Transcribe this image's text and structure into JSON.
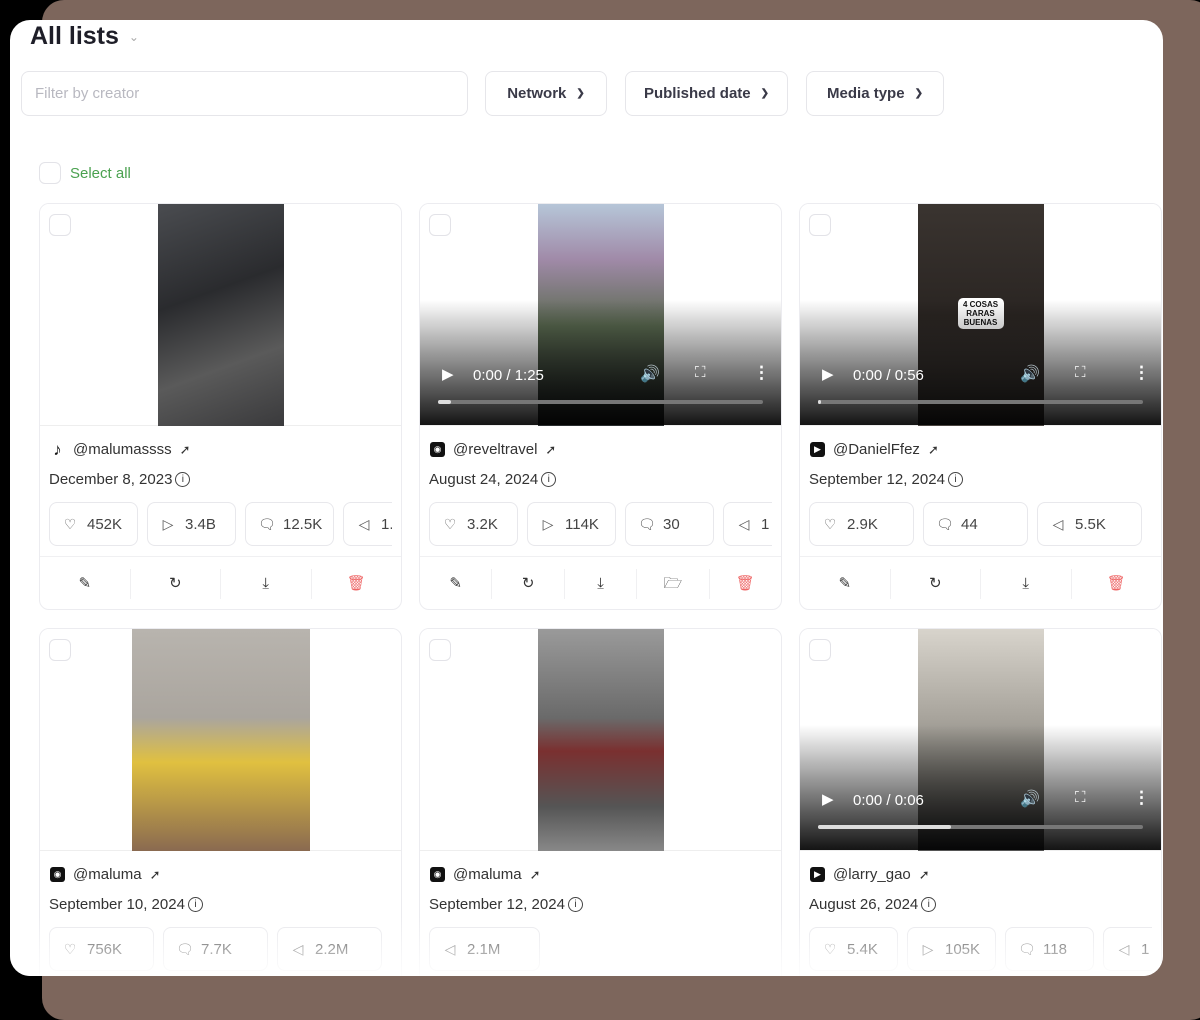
{
  "header": {
    "title": "All lists"
  },
  "filters": {
    "creator_placeholder": "Filter by creator",
    "network": "Network",
    "published_date": "Published date",
    "media_type": "Media type"
  },
  "select_all": "Select all",
  "colors": {
    "accent_green": "#4aa14f",
    "delete_red": "#e66666",
    "frame_brown": "#7d665c"
  },
  "cards": [
    {
      "network": "tiktok",
      "handle": "@malumassss",
      "date": "December 8, 2023",
      "media": "image",
      "stats": [
        {
          "icon": "heart",
          "value": "452K"
        },
        {
          "icon": "play",
          "value": "3.4B"
        },
        {
          "icon": "comment",
          "value": "12.5K"
        },
        {
          "icon": "megaphone",
          "value": "1."
        }
      ],
      "actions": [
        "edit",
        "refresh",
        "download",
        "delete"
      ]
    },
    {
      "network": "instagram",
      "handle": "@reveltravel",
      "date": "August 24, 2024",
      "media": "video",
      "time": "0:00 / 1:25",
      "progress": 0.04,
      "stats": [
        {
          "icon": "heart",
          "value": "3.2K"
        },
        {
          "icon": "play",
          "value": "114K"
        },
        {
          "icon": "comment",
          "value": "30"
        },
        {
          "icon": "megaphone",
          "value": "1"
        }
      ],
      "actions": [
        "edit",
        "refresh",
        "download",
        "folder",
        "delete"
      ]
    },
    {
      "network": "youtube",
      "handle": "@DanielFfez",
      "date": "September 12, 2024",
      "media": "video",
      "time": "0:00 / 0:56",
      "overlay_text": "4 COSAS RARAS BUENAS",
      "progress": 0.01,
      "stats": [
        {
          "icon": "heart",
          "value": "2.9K"
        },
        {
          "icon": "comment",
          "value": "44"
        },
        {
          "icon": "megaphone",
          "value": "5.5K"
        }
      ],
      "actions": [
        "edit",
        "refresh",
        "download",
        "delete"
      ]
    },
    {
      "network": "instagram",
      "handle": "@maluma",
      "date": "September 10, 2024",
      "media": "image",
      "stats": [
        {
          "icon": "heart",
          "value": "756K"
        },
        {
          "icon": "comment",
          "value": "7.7K"
        },
        {
          "icon": "megaphone",
          "value": "2.2M"
        }
      ],
      "actions": []
    },
    {
      "network": "instagram",
      "handle": "@maluma",
      "date": "September 12, 2024",
      "media": "image",
      "stats": [
        {
          "icon": "megaphone",
          "value": "2.1M"
        }
      ],
      "actions": []
    },
    {
      "network": "youtube",
      "handle": "@larry_gao",
      "date": "August 26, 2024",
      "media": "video",
      "time": "0:00 / 0:06",
      "progress": 0.41,
      "stats": [
        {
          "icon": "heart",
          "value": "5.4K"
        },
        {
          "icon": "play",
          "value": "105K"
        },
        {
          "icon": "comment",
          "value": "118"
        },
        {
          "icon": "megaphone",
          "value": "1"
        }
      ],
      "actions": []
    }
  ]
}
